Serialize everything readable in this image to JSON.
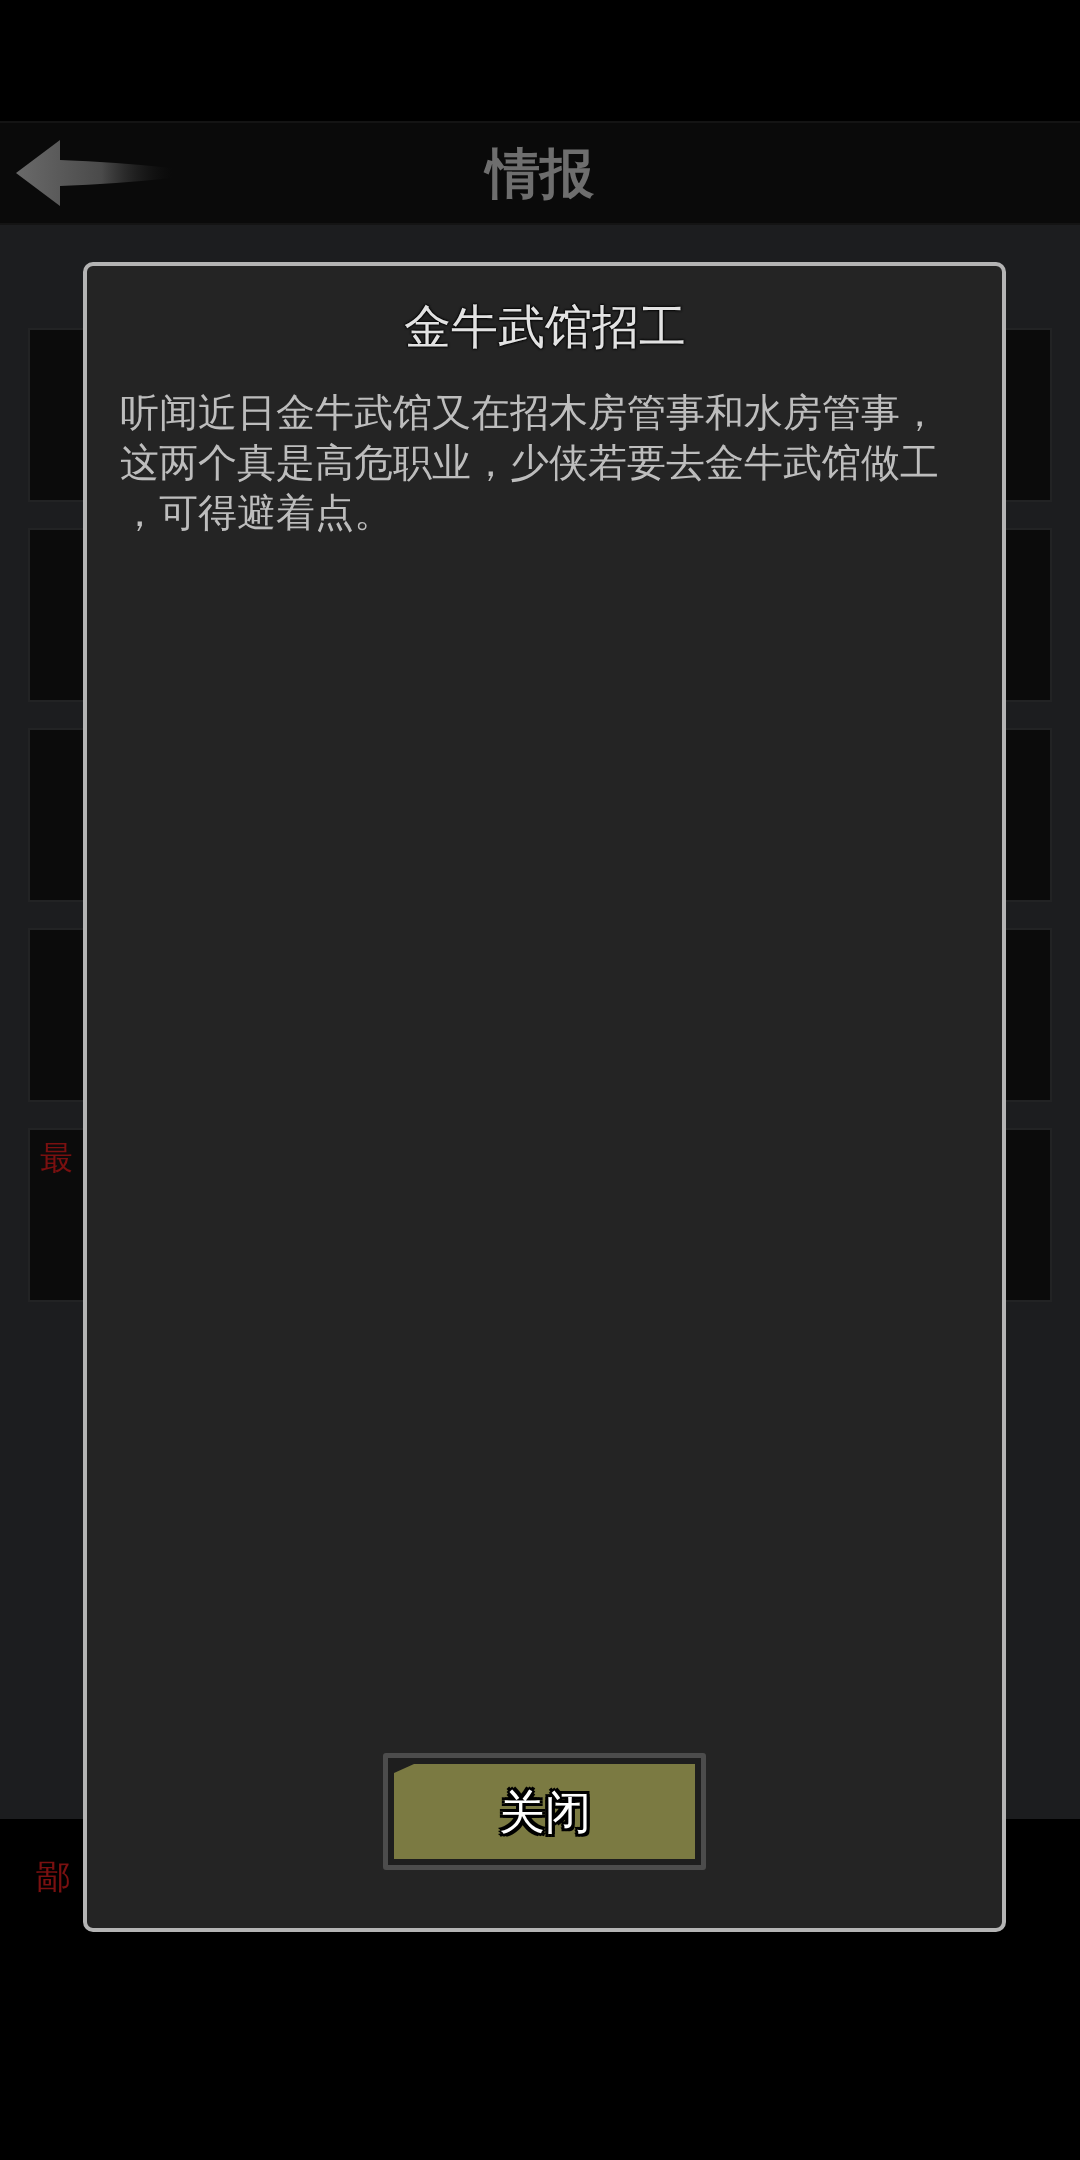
{
  "header": {
    "title": "情报"
  },
  "list": {
    "cards": [
      {
        "kind": "blank"
      },
      {
        "kind": "blank"
      },
      {
        "kind": "blank"
      },
      {
        "kind": "blank"
      },
      {
        "kind": "labeled",
        "label": "最"
      }
    ]
  },
  "footer": {
    "text": "鄙"
  },
  "dialog": {
    "title": "金牛武馆招工",
    "body": "听闻近日金牛武馆又在招木房管事和水房管事，这两个真是高危职业，少侠若要去金牛武馆做工，可得避着点。",
    "button": "关闭"
  }
}
